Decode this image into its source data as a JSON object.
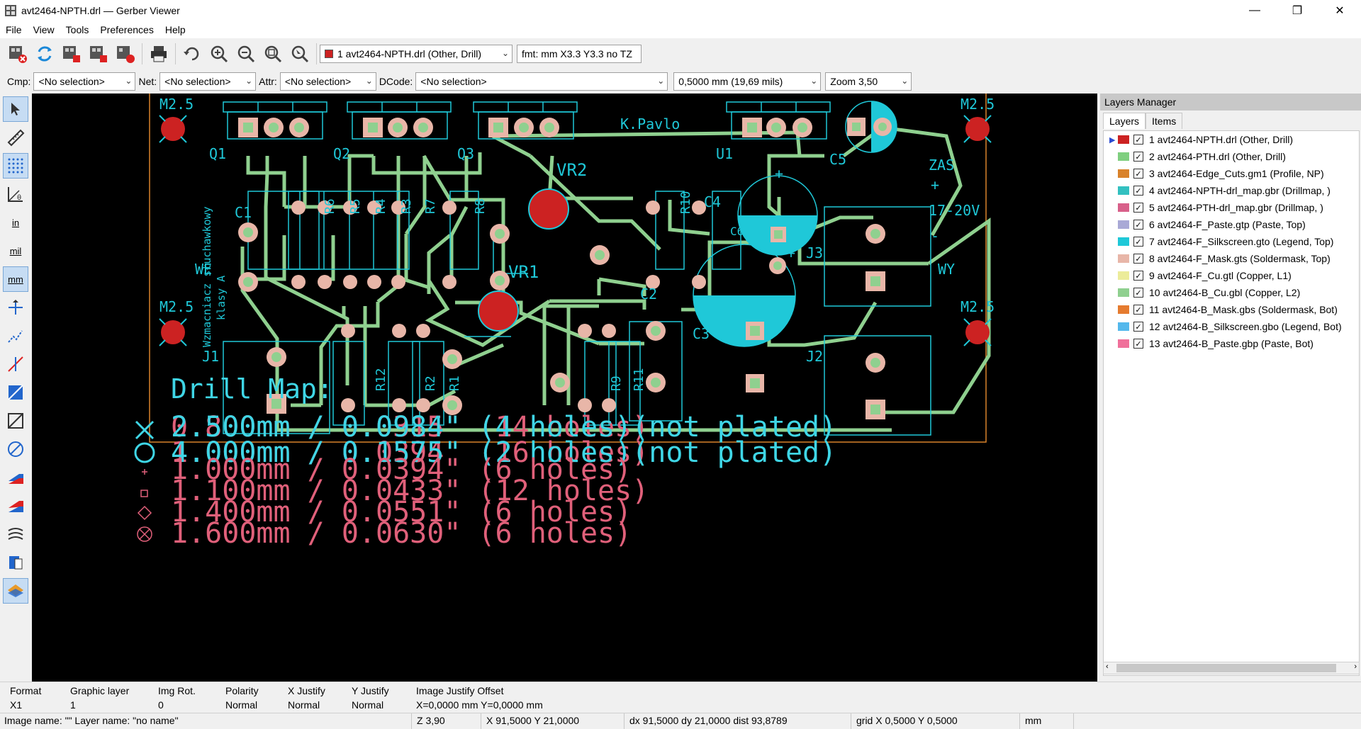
{
  "window": {
    "title": "avt2464-NPTH.drl — Gerber Viewer",
    "minimize_glyph": "—",
    "maximize_glyph": "❐",
    "close_glyph": "✕"
  },
  "menu": [
    "File",
    "View",
    "Tools",
    "Preferences",
    "Help"
  ],
  "toolbar": {
    "active_layer": "1 avt2464-NPTH.drl (Other, Drill)",
    "active_layer_color": "#cc2222",
    "format": "fmt: mm X3.3 Y3.3 no TZ"
  },
  "filter_bar": {
    "cmp_label": "Cmp:",
    "cmp_value": "<No selection>",
    "net_label": "Net:",
    "net_value": "<No selection>",
    "attr_label": "Attr:",
    "attr_value": "<No selection>",
    "dcode_label": "DCode:",
    "dcode_value": "<No selection>",
    "grid_value": "0,5000 mm (19,69 mils)",
    "zoom_value": "Zoom 3,50"
  },
  "left_toolbar": {
    "in_label": "in",
    "mil_label": "mil",
    "mm_label": "mm"
  },
  "board": {
    "labels": {
      "m25": "M2.5",
      "q1": "Q1",
      "q2": "Q2",
      "q3": "Q3",
      "u1": "U1",
      "author": "K.Pavlo",
      "vr2": "VR2",
      "vr1": "VR1",
      "c5": "C5",
      "zas": "ZAS",
      "plus": "+",
      "voltage": "17-20V",
      "minus": "-",
      "c1": "C1",
      "c2": "C2",
      "c3": "C3",
      "c4": "C4",
      "c6": "C6",
      "r6": "R6",
      "r5": "R5",
      "r4": "R4",
      "r3": "R3",
      "r7": "R7",
      "r8": "R8",
      "r10": "R10",
      "r12": "R12",
      "r2": "R2",
      "r1": "R1",
      "r9": "R9",
      "r11": "R11",
      "j1": "J1",
      "j2": "J2",
      "j3": "J3",
      "we": "WE",
      "wy": "WY",
      "side_text_1": "Wzmacniacz słuchawkowy",
      "side_text_2": "klasy A"
    }
  },
  "drill_map": {
    "title": "Drill Map:",
    "rows": [
      {
        "text": "2.500mm / 0.0984\" (4 holes)(not plated)",
        "color": "#3fd6e6"
      },
      {
        "text": "4.000mm / 0.1575\" (2 holes)(not plated)",
        "color": "#3fd6e6"
      },
      {
        "text": "1.000mm / 0.0394\" (6 holes)",
        "color": "#e0607a"
      },
      {
        "text": "1.100mm / 0.0433\" (12 holes)",
        "color": "#e0607a"
      },
      {
        "text": "1.400mm / 0.0551\" (6 holes)",
        "color": "#e0607a"
      },
      {
        "text": "1.600mm / 0.0630\" (6 holes)",
        "color": "#e0607a"
      }
    ],
    "overlay_rows": [
      {
        "text": "0.800mm / 0.0315\" (14 holes)",
        "color": "#e0607a"
      },
      {
        "text": "1.000mm / 0.0394\" (16 holes)",
        "color": "#e0607a"
      }
    ]
  },
  "layers_manager": {
    "title": "Layers Manager",
    "tabs": [
      "Layers",
      "Items"
    ],
    "layers": [
      {
        "label": "1 avt2464-NPTH.drl (Other, Drill)",
        "color": "#cc2222",
        "active": true
      },
      {
        "label": "2 avt2464-PTH.drl (Other, Drill)",
        "color": "#7fcf7f"
      },
      {
        "label": "3 avt2464-Edge_Cuts.gm1 (Profile, NP)",
        "color": "#d9822b"
      },
      {
        "label": "4 avt2464-NPTH-drl_map.gbr (Drillmap, )",
        "color": "#33c0c0"
      },
      {
        "label": "5 avt2464-PTH-drl_map.gbr (Drillmap, )",
        "color": "#d8608a"
      },
      {
        "label": "6 avt2464-F_Paste.gtp (Paste, Top)",
        "color": "#a9a9d6"
      },
      {
        "label": "7 avt2464-F_Silkscreen.gto (Legend, Top)",
        "color": "#1fc8d8"
      },
      {
        "label": "8 avt2464-F_Mask.gts (Soldermask, Top)",
        "color": "#e8b6a8"
      },
      {
        "label": "9 avt2464-F_Cu.gtl (Copper, L1)",
        "color": "#ecec9a"
      },
      {
        "label": "10 avt2464-B_Cu.gbl (Copper, L2)",
        "color": "#8fd08f"
      },
      {
        "label": "11 avt2464-B_Mask.gbs (Soldermask, Bot)",
        "color": "#e57b2f"
      },
      {
        "label": "12 avt2464-B_Silkscreen.gbo (Legend, Bot)",
        "color": "#54b8ec"
      },
      {
        "label": "13 avt2464-B_Paste.gbp (Paste, Bot)",
        "color": "#f0709a"
      }
    ]
  },
  "status": {
    "format_h": "Format",
    "format_v": "X1",
    "graphic_layer_h": "Graphic layer",
    "graphic_layer_v": "1",
    "img_rot_h": "Img Rot.",
    "img_rot_v": "0",
    "polarity_h": "Polarity",
    "polarity_v": "Normal",
    "xjustify_h": "X Justify",
    "xjustify_v": "Normal",
    "yjustify_h": "Y Justify",
    "yjustify_v": "Normal",
    "offset_h": "Image Justify Offset",
    "offset_v": "X=0,0000 mm Y=0,0000 mm",
    "image_name": "Image name: \"\"  Layer name: \"no name\"",
    "zoom": "Z 3,90",
    "xy": "X 91,5000  Y 21,0000",
    "delta": "dx 91,5000  dy 21,0000  dist 93,8789",
    "grid": "grid X 0,5000  Y 0,5000",
    "units": "mm"
  },
  "colors": {
    "canvas_bg": "#000000",
    "trace": "#8fd08f",
    "silk": "#1fc8d8",
    "mask_pad": "#e8b6a8",
    "npth": "#cc2222",
    "edge": "#d9822b",
    "drill_cyan": "#3fd6e6",
    "drill_pink": "#e0607a"
  }
}
